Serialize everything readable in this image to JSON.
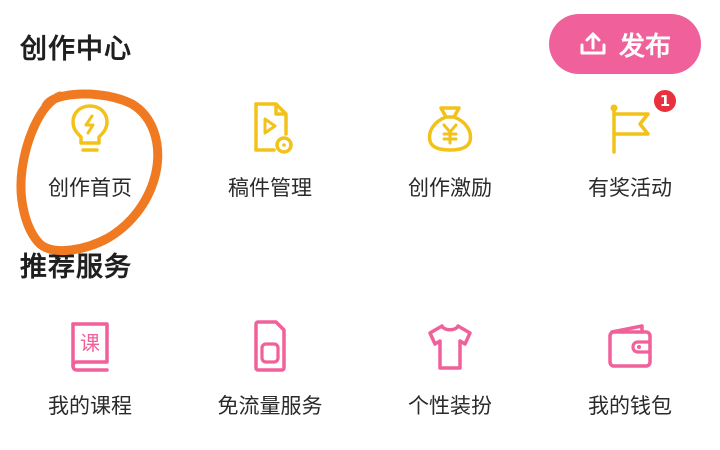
{
  "creation_center": {
    "title": "创作中心",
    "publish_button": "发布",
    "items": [
      {
        "label": "创作首页",
        "icon": "lightbulb-icon"
      },
      {
        "label": "稿件管理",
        "icon": "video-file-icon"
      },
      {
        "label": "创作激励",
        "icon": "money-bag-icon"
      },
      {
        "label": "有奖活动",
        "icon": "flag-icon",
        "badge": "1"
      }
    ]
  },
  "recommended_services": {
    "title": "推荐服务",
    "items": [
      {
        "label": "我的课程",
        "icon": "course-book-icon",
        "icon_text": "课"
      },
      {
        "label": "免流量服务",
        "icon": "sim-card-icon"
      },
      {
        "label": "个性装扮",
        "icon": "tshirt-icon"
      },
      {
        "label": "我的钱包",
        "icon": "wallet-icon"
      }
    ]
  },
  "colors": {
    "accent_pink": "#f0609a",
    "creation_icon_yellow": "#f2c21b",
    "badge_red": "#e8303f",
    "annotation_orange": "#f07a22"
  }
}
